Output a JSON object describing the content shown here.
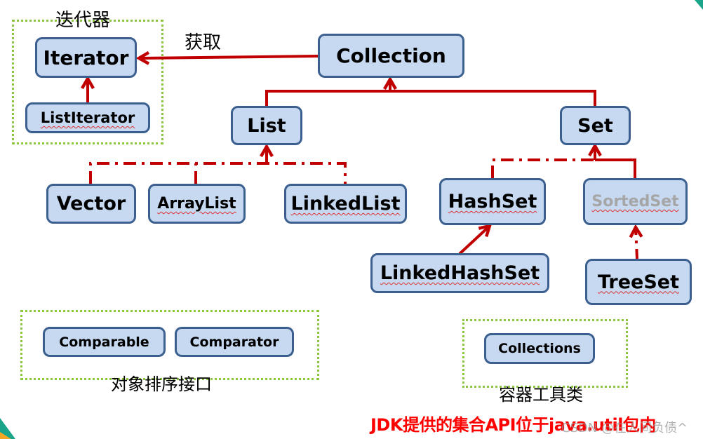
{
  "colors": {
    "node_fill": "#c6d9f1",
    "node_border": "#3b5f8f",
    "arrow": "#c00000",
    "group_border": "#8cc63f",
    "footer_text": "#ff0000"
  },
  "groups": {
    "iterator_group_label": "迭代器",
    "sorting_group_label": "对象排序接口",
    "utility_group_label": "容器工具类"
  },
  "edge_labels": {
    "obtain": "获取"
  },
  "nodes": {
    "iterator": "Iterator",
    "list_iterator": "ListIterator",
    "collection": "Collection",
    "list": "List",
    "set": "Set",
    "vector": "Vector",
    "array_list": "ArrayList",
    "linked_list": "LinkedList",
    "hash_set": "HashSet",
    "sorted_set": "SortedSet",
    "linked_hash_set": "LinkedHashSet",
    "tree_set": "TreeSet",
    "comparable": "Comparable",
    "comparator": "Comparator",
    "collections": "Collections"
  },
  "edges": [
    {
      "from": "Collection",
      "to": "Iterator",
      "style": "solid",
      "label": "获取"
    },
    {
      "from": "ListIterator",
      "to": "Iterator",
      "style": "solid"
    },
    {
      "from": "List",
      "to": "Collection",
      "style": "solid"
    },
    {
      "from": "Set",
      "to": "Collection",
      "style": "solid"
    },
    {
      "from": "Vector",
      "to": "List",
      "style": "dash-dot"
    },
    {
      "from": "ArrayList",
      "to": "List",
      "style": "dash-dot"
    },
    {
      "from": "LinkedList",
      "to": "List",
      "style": "dash-dot"
    },
    {
      "from": "HashSet",
      "to": "Set",
      "style": "dash-dot"
    },
    {
      "from": "SortedSet",
      "to": "Set",
      "style": "solid"
    },
    {
      "from": "LinkedHashSet",
      "to": "HashSet",
      "style": "solid"
    },
    {
      "from": "TreeSet",
      "to": "SortedSet",
      "style": "dash-dot"
    }
  ],
  "footer": {
    "note": "JDK提供的集合API位于java.util包内",
    "watermark": "CSDN @在人间负债^"
  }
}
